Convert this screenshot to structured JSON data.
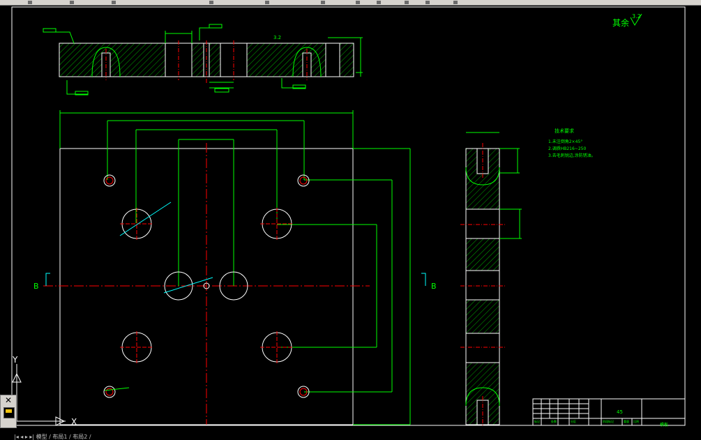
{
  "app": {
    "name": "CAD drawing viewer",
    "background": "#000000"
  },
  "colors": {
    "dimension": "#00ff00",
    "outline": "#ffffff",
    "center_line": "#ff0000",
    "hatch": "#00cc00",
    "cyan": "#00ffff",
    "annotation": "#00ff00"
  },
  "drawing": {
    "roughness_note": "其余",
    "roughness_value": "3.2",
    "section_marker_left": "B",
    "section_marker_right": "B",
    "tech_req_title": "技术要求",
    "tech_req_lines": [
      "1.未注倒角2×45°",
      "2.调质HB216~250",
      "3.去毛刺锐边,涂防锈油。"
    ]
  },
  "title_block": {
    "material": "45",
    "part_name": "模板",
    "labels": [
      "标记",
      "处数",
      "分区",
      "更改文件号",
      "签名",
      "年月日"
    ],
    "row2": [
      "设计",
      "标准化",
      "阶段标记",
      "重量",
      "比例"
    ],
    "scale": "1:1"
  },
  "ucs": {
    "y_axis": "Y",
    "x_axis": "X"
  },
  "layout_tabs": {
    "text": "|◂ ◂ ▸ ▸| 模型 / 布局1 / 布局2 /"
  },
  "icons": [
    "close-icon",
    "properties-icon",
    "ucs-icon"
  ]
}
